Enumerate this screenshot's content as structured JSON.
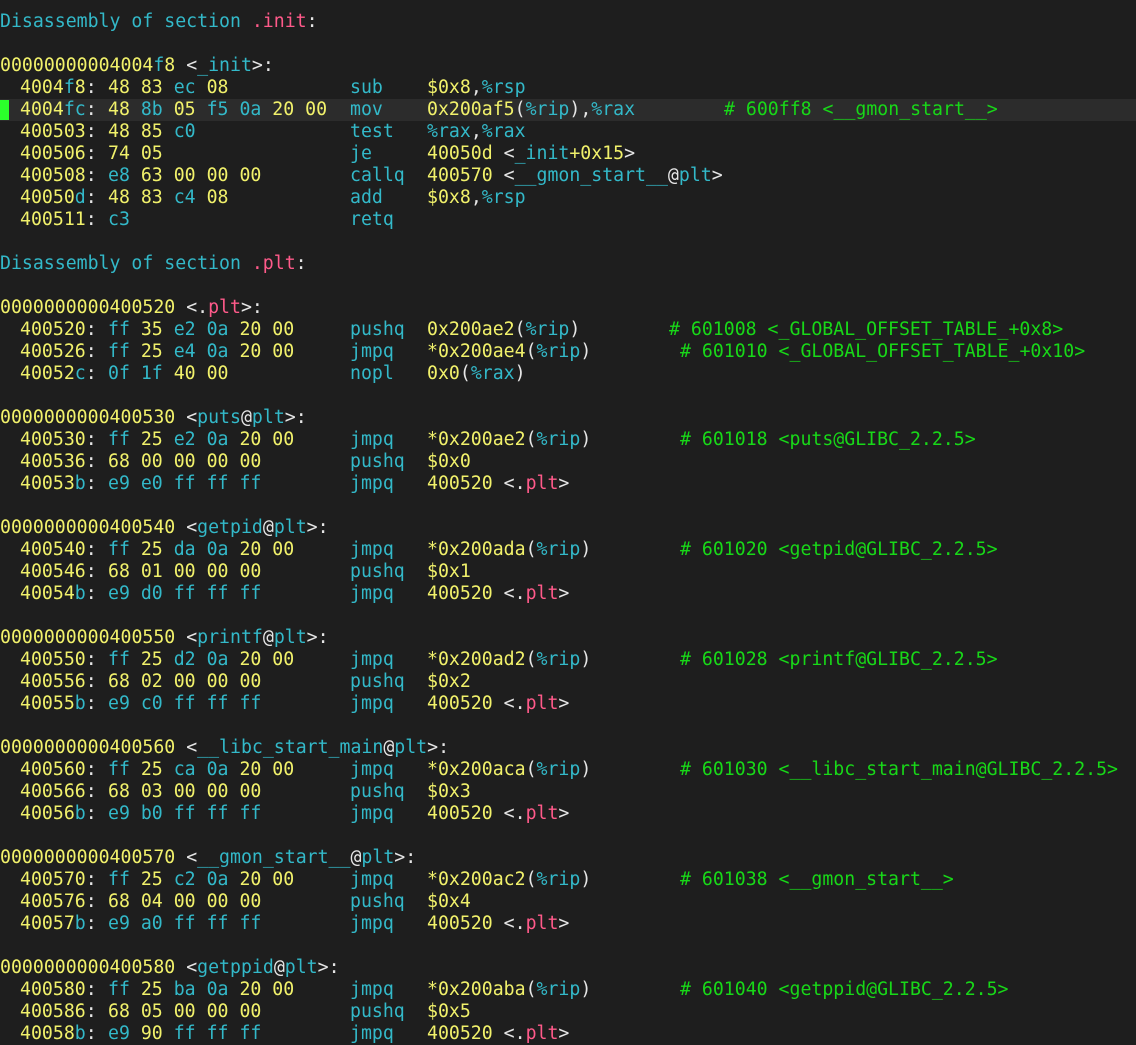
{
  "sections": [
    {
      "header": "Disassembly of section .init:",
      "functions": [
        {
          "label": "00000000004004f8 <_init>:",
          "rows": [
            {
              "addr": "4004f8:",
              "bytes": "48 83 ec 08",
              "op": "sub",
              "args": "$0x8,%rsp",
              "comment": ""
            },
            {
              "addr": "4004fc:",
              "bytes": "48 8b 05 f5 0a 20 00",
              "op": "mov",
              "args": "0x200af5(%rip),%rax",
              "comment": "# 600ff8 <__gmon_start__>",
              "highlight": true
            },
            {
              "addr": "400503:",
              "bytes": "48 85 c0",
              "op": "test",
              "args": "%rax,%rax",
              "comment": ""
            },
            {
              "addr": "400506:",
              "bytes": "74 05",
              "op": "je",
              "args": "40050d <_init+0x15>",
              "comment": ""
            },
            {
              "addr": "400508:",
              "bytes": "e8 63 00 00 00",
              "op": "callq",
              "args": "400570 <__gmon_start__@plt>",
              "comment": ""
            },
            {
              "addr": "40050d:",
              "bytes": "48 83 c4 08",
              "op": "add",
              "args": "$0x8,%rsp",
              "comment": ""
            },
            {
              "addr": "400511:",
              "bytes": "c3",
              "op": "retq",
              "args": "",
              "comment": ""
            }
          ]
        }
      ]
    },
    {
      "header": "Disassembly of section .plt:",
      "functions": [
        {
          "label": "0000000000400520 <.plt>:",
          "rows": [
            {
              "addr": "400520:",
              "bytes": "ff 35 e2 0a 20 00",
              "op": "pushq",
              "args": "0x200ae2(%rip)",
              "comment": "# 601008 <_GLOBAL_OFFSET_TABLE_+0x8>",
              "commentCol": "short"
            },
            {
              "addr": "400526:",
              "bytes": "ff 25 e4 0a 20 00",
              "op": "jmpq",
              "args": "*0x200ae4(%rip)",
              "comment": "# 601010 <_GLOBAL_OFFSET_TABLE_+0x10>"
            },
            {
              "addr": "40052c:",
              "bytes": "0f 1f 40 00",
              "op": "nopl",
              "args": "0x0(%rax)",
              "comment": ""
            }
          ]
        },
        {
          "label": "0000000000400530 <puts@plt>:",
          "rows": [
            {
              "addr": "400530:",
              "bytes": "ff 25 e2 0a 20 00",
              "op": "jmpq",
              "args": "*0x200ae2(%rip)",
              "comment": "# 601018 <puts@GLIBC_2.2.5>"
            },
            {
              "addr": "400536:",
              "bytes": "68 00 00 00 00",
              "op": "pushq",
              "args": "$0x0",
              "comment": ""
            },
            {
              "addr": "40053b:",
              "bytes": "e9 e0 ff ff ff",
              "op": "jmpq",
              "args": "400520 <.plt>",
              "comment": ""
            }
          ]
        },
        {
          "label": "0000000000400540 <getpid@plt>:",
          "rows": [
            {
              "addr": "400540:",
              "bytes": "ff 25 da 0a 20 00",
              "op": "jmpq",
              "args": "*0x200ada(%rip)",
              "comment": "# 601020 <getpid@GLIBC_2.2.5>"
            },
            {
              "addr": "400546:",
              "bytes": "68 01 00 00 00",
              "op": "pushq",
              "args": "$0x1",
              "comment": ""
            },
            {
              "addr": "40054b:",
              "bytes": "e9 d0 ff ff ff",
              "op": "jmpq",
              "args": "400520 <.plt>",
              "comment": ""
            }
          ]
        },
        {
          "label": "0000000000400550 <printf@plt>:",
          "rows": [
            {
              "addr": "400550:",
              "bytes": "ff 25 d2 0a 20 00",
              "op": "jmpq",
              "args": "*0x200ad2(%rip)",
              "comment": "# 601028 <printf@GLIBC_2.2.5>"
            },
            {
              "addr": "400556:",
              "bytes": "68 02 00 00 00",
              "op": "pushq",
              "args": "$0x2",
              "comment": ""
            },
            {
              "addr": "40055b:",
              "bytes": "e9 c0 ff ff ff",
              "op": "jmpq",
              "args": "400520 <.plt>",
              "comment": ""
            }
          ]
        },
        {
          "label": "0000000000400560 <__libc_start_main@plt>:",
          "rows": [
            {
              "addr": "400560:",
              "bytes": "ff 25 ca 0a 20 00",
              "op": "jmpq",
              "args": "*0x200aca(%rip)",
              "comment": "# 601030 <__libc_start_main@GLIBC_2.2.5>"
            },
            {
              "addr": "400566:",
              "bytes": "68 03 00 00 00",
              "op": "pushq",
              "args": "$0x3",
              "comment": ""
            },
            {
              "addr": "40056b:",
              "bytes": "e9 b0 ff ff ff",
              "op": "jmpq",
              "args": "400520 <.plt>",
              "comment": ""
            }
          ]
        },
        {
          "label": "0000000000400570 <__gmon_start__@plt>:",
          "rows": [
            {
              "addr": "400570:",
              "bytes": "ff 25 c2 0a 20 00",
              "op": "jmpq",
              "args": "*0x200ac2(%rip)",
              "comment": "# 601038 <__gmon_start__>"
            },
            {
              "addr": "400576:",
              "bytes": "68 04 00 00 00",
              "op": "pushq",
              "args": "$0x4",
              "comment": ""
            },
            {
              "addr": "40057b:",
              "bytes": "e9 a0 ff ff ff",
              "op": "jmpq",
              "args": "400520 <.plt>",
              "comment": ""
            }
          ]
        },
        {
          "label": "0000000000400580 <getppid@plt>:",
          "rows": [
            {
              "addr": "400580:",
              "bytes": "ff 25 ba 0a 20 00",
              "op": "jmpq",
              "args": "*0x200aba(%rip)",
              "comment": "# 601040 <getppid@GLIBC_2.2.5>"
            },
            {
              "addr": "400586:",
              "bytes": "68 05 00 00 00",
              "op": "pushq",
              "args": "$0x5",
              "comment": ""
            },
            {
              "addr": "40058b:",
              "bytes": "e9 90 ff ff ff",
              "op": "jmpq",
              "args": "400520 <.plt>",
              "comment": ""
            }
          ]
        }
      ]
    }
  ],
  "colors": {
    "background": "#1e1e1e",
    "highlight_line": "#2c2c2c",
    "cursor": "#2bff2b",
    "cyan": "#33b9c9",
    "yellow": "#f1f16b",
    "pink": "#ff5a8a",
    "comment_green": "#18d818"
  }
}
